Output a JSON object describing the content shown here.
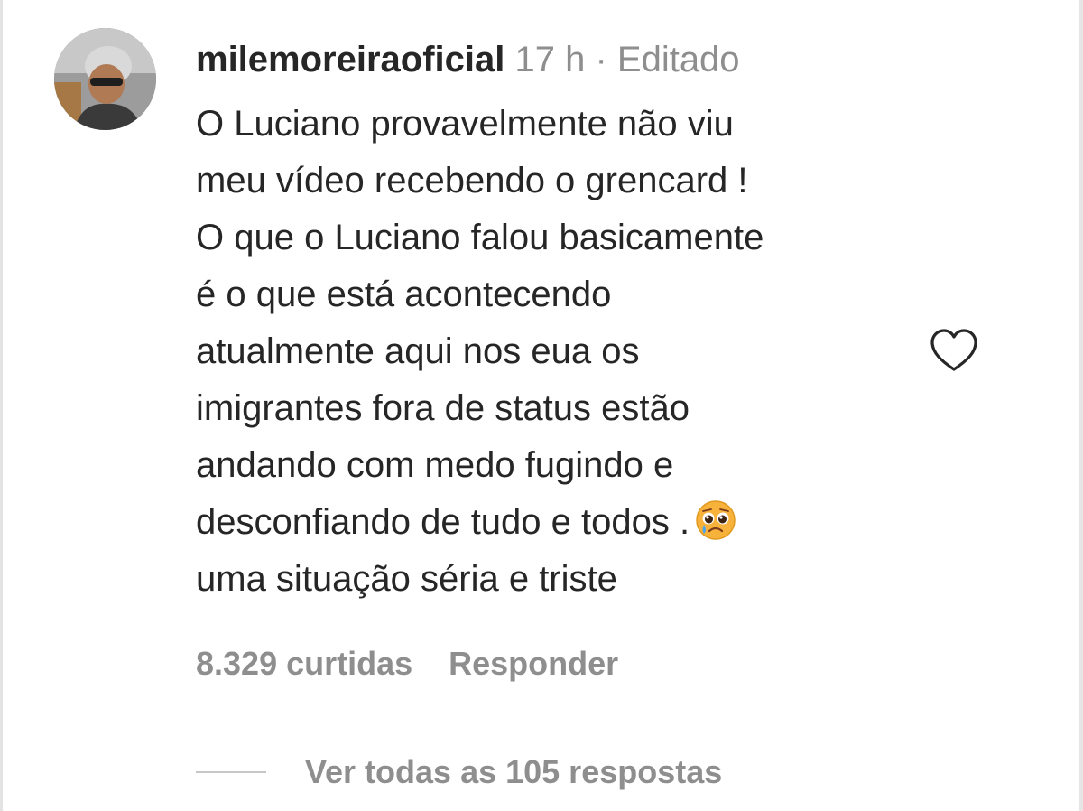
{
  "comment": {
    "username": "milemoreiraoficial",
    "meta": " 17 h · Editado",
    "lines": [
      "O Luciano provavelmente não viu",
      "meu vídeo recebendo o grencard !",
      "O que o Luciano falou basicamente",
      "é o que está acontecendo",
      "atualmente aqui nos eua os",
      "imigrantes fora de status estão",
      "andando com medo fugindo e",
      "desconfiando de tudo e todos .",
      "uma situação séria e triste"
    ],
    "emoji": "pleading-face-with-tear",
    "likes": "8.329 curtidas",
    "reply_label": "Responder",
    "view_replies_label": "Ver todas as 105 respostas"
  },
  "icons": {
    "like": "heart-outline-icon",
    "avatar": "profile-photo"
  },
  "colors": {
    "text_primary": "#262626",
    "text_secondary": "#8e8e8e",
    "divider": "#c7c7c7"
  }
}
